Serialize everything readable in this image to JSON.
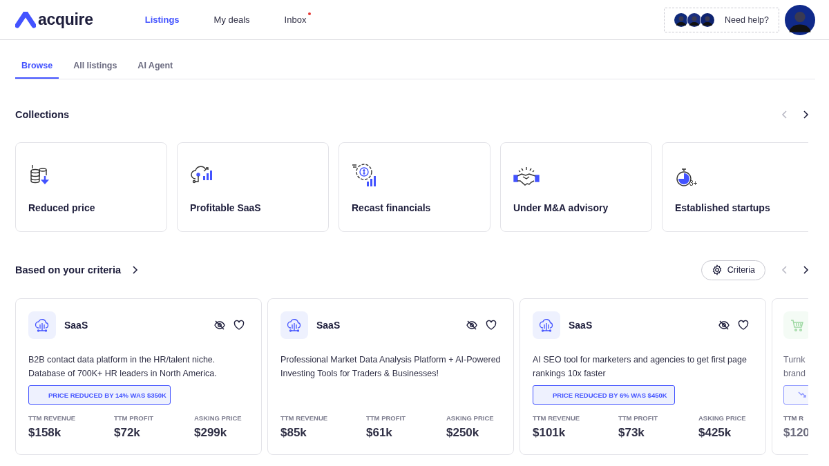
{
  "header": {
    "logo": "acquire",
    "nav": [
      {
        "label": "Listings",
        "selected": true,
        "unread": false
      },
      {
        "label": "My deals",
        "selected": false,
        "unread": false
      },
      {
        "label": "Inbox",
        "selected": false,
        "unread": true
      }
    ],
    "help": "Need help?"
  },
  "tabs": [
    {
      "label": "Browse",
      "selected": true
    },
    {
      "label": "All listings",
      "selected": false
    },
    {
      "label": "AI Agent",
      "selected": false
    }
  ],
  "collections": {
    "title": "Collections",
    "items": [
      {
        "kind": "coins",
        "label": "Reduced price"
      },
      {
        "kind": "cloud-chart",
        "label": "Profitable SaaS"
      },
      {
        "kind": "gear-chart",
        "label": "Recast financials"
      },
      {
        "kind": "handshake",
        "label": "Under M&A advisory"
      },
      {
        "kind": "stopwatch",
        "label": "Established startups",
        "icon_text": "3+"
      }
    ]
  },
  "criteria": {
    "title": "Based on your criteria",
    "button": "Criteria",
    "listings": [
      {
        "kind": "saas",
        "category": "SaaS",
        "description": "B2B contact data platform in the HR/talent niche. Database of 700K+ HR leaders in North America.",
        "badge": {
          "text": "PRICE REDUCED BY 14% WAS $350K"
        },
        "metrics": [
          {
            "label": "TTM REVENUE",
            "value": "$158k"
          },
          {
            "label": "TTM PROFIT",
            "value": "$72k"
          },
          {
            "label": "ASKING PRICE",
            "value": "$299k"
          }
        ]
      },
      {
        "kind": "saas",
        "category": "SaaS",
        "description": "Professional Market Data Analysis Platform + AI-Powered Investing Tools for Traders & Businesses!",
        "metrics": [
          {
            "label": "TTM REVENUE",
            "value": "$85k"
          },
          {
            "label": "TTM PROFIT",
            "value": "$61k"
          },
          {
            "label": "ASKING PRICE",
            "value": "$250k"
          }
        ]
      },
      {
        "kind": "saas",
        "category": "SaaS",
        "description": "AI SEO tool for marketers and agencies to get first page rankings 10x faster",
        "badge": {
          "text": "PRICE REDUCED BY 6% WAS $450K"
        },
        "metrics": [
          {
            "label": "TTM REVENUE",
            "value": "$101k"
          },
          {
            "label": "TTM PROFIT",
            "value": "$73k"
          },
          {
            "label": "ASKING PRICE",
            "value": "$425k"
          }
        ]
      },
      {
        "kind": "ecommerce",
        "description_lines": [
          "Turnk",
          "brand"
        ],
        "reduced": true,
        "metrics": [
          {
            "label": "TTM R",
            "value": "$120"
          }
        ]
      }
    ]
  }
}
